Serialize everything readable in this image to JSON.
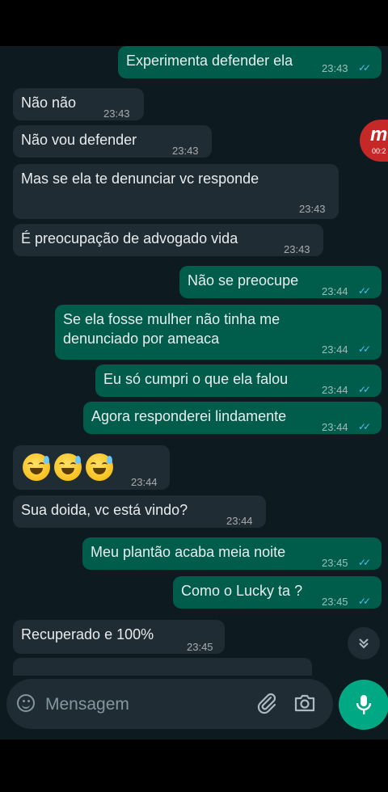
{
  "messages": [
    {
      "direction": "out",
      "text": "Experimenta defender ela",
      "time": "23:43",
      "read": true
    },
    {
      "direction": "in",
      "text": "Não não",
      "time": "23:43"
    },
    {
      "direction": "in",
      "text": "Não vou defender",
      "time": "23:43"
    },
    {
      "direction": "in",
      "text": "Mas se ela te denunciar vc responde",
      "time": "23:43"
    },
    {
      "direction": "in",
      "text": "É preocupação de advogado vida",
      "time": "23:43"
    },
    {
      "direction": "out",
      "text": "Não se preocupe",
      "time": "23:44",
      "read": true
    },
    {
      "direction": "out",
      "text": "Se ela fosse mulher não tinha me\ndenunciado por ameaca",
      "time": "23:44",
      "read": true
    },
    {
      "direction": "out",
      "text": "Eu só cumpri o que ela falou",
      "time": "23:44",
      "read": true
    },
    {
      "direction": "out",
      "text": "Agora responderei lindamente",
      "time": "23:44",
      "read": true
    },
    {
      "direction": "in",
      "emoji": [
        "grinning-sweat-emoji",
        "grinning-sweat-emoji",
        "grinning-sweat-emoji"
      ],
      "time": "23:44"
    },
    {
      "direction": "in",
      "text": "Sua doida, vc está vindo?",
      "time": "23:44"
    },
    {
      "direction": "out",
      "text": "Meu plantão acaba meia noite",
      "time": "23:45",
      "read": true
    },
    {
      "direction": "out",
      "text": "Como o Lucky ta ?",
      "time": "23:45",
      "read": true
    },
    {
      "direction": "in",
      "text": "Recuperado e 100%",
      "time": "23:45"
    }
  ],
  "floating_app": {
    "letter": "m",
    "timer": "00:2"
  },
  "input": {
    "placeholder": "Mensagem",
    "value": ""
  },
  "icons": {
    "emoji": "smiley-icon",
    "attach": "paperclip-icon",
    "camera": "camera-icon",
    "mic": "microphone-icon",
    "scroll": "double-chevron-down-icon",
    "ticks": "double-check-icon"
  },
  "colors": {
    "background": "#0d1a20",
    "incoming": "#1f2c33",
    "outgoing": "#005c4b",
    "accent": "#00a884",
    "read_ticks": "#53bdeb"
  }
}
